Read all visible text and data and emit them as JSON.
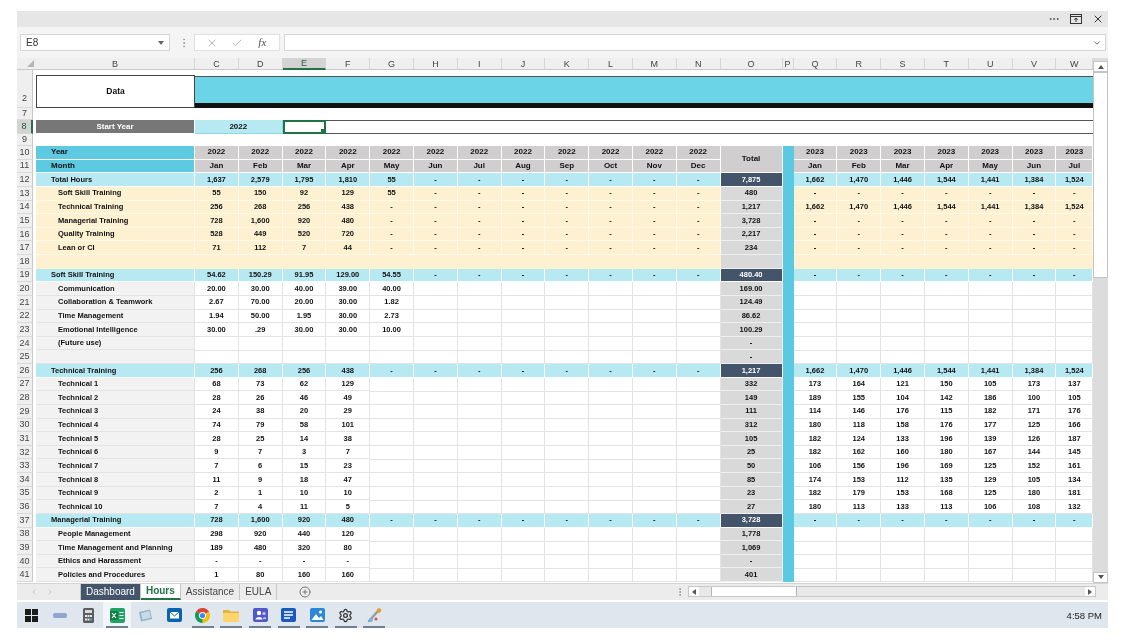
{
  "formula_bar": {
    "name_box": "E8",
    "function_label": "fx"
  },
  "columns": [
    {
      "label": "B",
      "selected": false
    },
    {
      "label": "C",
      "selected": false
    },
    {
      "label": "D",
      "selected": false
    },
    {
      "label": "E",
      "selected": true
    },
    {
      "label": "F",
      "selected": false
    },
    {
      "label": "G",
      "selected": false
    },
    {
      "label": "H",
      "selected": false
    },
    {
      "label": "I",
      "selected": false
    },
    {
      "label": "J",
      "selected": false
    },
    {
      "label": "K",
      "selected": false
    },
    {
      "label": "L",
      "selected": false
    },
    {
      "label": "M",
      "selected": false
    },
    {
      "label": "N",
      "selected": false
    },
    {
      "label": "O",
      "selected": false
    },
    {
      "label": "P",
      "selected": false
    },
    {
      "label": "Q",
      "selected": false
    },
    {
      "label": "R",
      "selected": false
    },
    {
      "label": "S",
      "selected": false
    },
    {
      "label": "T",
      "selected": false
    },
    {
      "label": "U",
      "selected": false
    },
    {
      "label": "V",
      "selected": false
    },
    {
      "label": "W",
      "selected": false
    }
  ],
  "rows": [
    {
      "kind": "banner",
      "number": "2",
      "selected": false,
      "label": "Data"
    },
    {
      "kind": "blank",
      "number": "7",
      "selected": false
    },
    {
      "kind": "start_year",
      "number": "8",
      "selected": true,
      "label": "Start Year",
      "value": "2022"
    },
    {
      "kind": "blank",
      "number": "9",
      "selected": false
    },
    {
      "kind": "header",
      "number": "10",
      "selected": false,
      "label": "Year",
      "values_2022": [
        "2022",
        "2022",
        "2022",
        "2022",
        "2022",
        "2022",
        "2022",
        "2022",
        "2022",
        "2022",
        "2022",
        "2022"
      ],
      "total": "Total",
      "values_2023": [
        "2023",
        "2023",
        "2023",
        "2023",
        "2023",
        "2023",
        "2023"
      ]
    },
    {
      "kind": "header",
      "number": "11",
      "selected": false,
      "label": "Month",
      "values_2022": [
        "Jan",
        "Feb",
        "Mar",
        "Apr",
        "May",
        "Jun",
        "Jul",
        "Aug",
        "Sep",
        "Oct",
        "Nov",
        "Dec"
      ],
      "values_2023": [
        "Jan",
        "Feb",
        "Mar",
        "Apr",
        "May",
        "Jun",
        "Jul"
      ]
    },
    {
      "kind": "section",
      "number": "12",
      "selected": false,
      "label": "Total Hours",
      "values_2022": [
        "1,637",
        "2,579",
        "1,795",
        "1,810",
        "55",
        "-",
        "-",
        "-",
        "-",
        "-",
        "-",
        "-"
      ],
      "total": "7,875",
      "values_2023": [
        "1,662",
        "1,470",
        "1,446",
        "1,544",
        "1,441",
        "1,384",
        "1,524"
      ]
    },
    {
      "kind": "breakdown",
      "number": "13",
      "selected": false,
      "label": "Soft Skill Training",
      "values_2022": [
        "55",
        "150",
        "92",
        "129",
        "55",
        "-",
        "-",
        "-",
        "-",
        "-",
        "-",
        "-"
      ],
      "total": "480",
      "values_2023": [
        "-",
        "-",
        "-",
        "-",
        "-",
        "-",
        "-"
      ]
    },
    {
      "kind": "breakdown",
      "number": "14",
      "selected": false,
      "label": "Technical Training",
      "values_2022": [
        "256",
        "268",
        "256",
        "438",
        "-",
        "-",
        "-",
        "-",
        "-",
        "-",
        "-",
        "-"
      ],
      "total": "1,217",
      "values_2023": [
        "1,662",
        "1,470",
        "1,446",
        "1,544",
        "1,441",
        "1,384",
        "1,524"
      ]
    },
    {
      "kind": "breakdown",
      "number": "15",
      "selected": false,
      "label": "Managerial Training",
      "values_2022": [
        "728",
        "1,600",
        "920",
        "480",
        "-",
        "-",
        "-",
        "-",
        "-",
        "-",
        "-",
        "-"
      ],
      "total": "3,728",
      "values_2023": [
        "-",
        "-",
        "-",
        "-",
        "-",
        "-",
        "-"
      ]
    },
    {
      "kind": "breakdown",
      "number": "16",
      "selected": false,
      "label": "Quality Training",
      "values_2022": [
        "528",
        "449",
        "520",
        "720",
        "-",
        "-",
        "-",
        "-",
        "-",
        "-",
        "-",
        "-"
      ],
      "total": "2,217",
      "values_2023": [
        "-",
        "-",
        "-",
        "-",
        "-",
        "-",
        "-"
      ]
    },
    {
      "kind": "breakdown",
      "number": "17",
      "selected": false,
      "label": "Lean or CI",
      "values_2022": [
        "71",
        "112",
        "7",
        "44",
        "-",
        "-",
        "-",
        "-",
        "-",
        "-",
        "-",
        "-"
      ],
      "total": "234",
      "values_2023": [
        "-",
        "-",
        "-",
        "-",
        "-",
        "-",
        "-"
      ]
    },
    {
      "kind": "spacer",
      "number": "18",
      "selected": false
    },
    {
      "kind": "section",
      "number": "19",
      "selected": false,
      "label": "Soft Skill Training",
      "values_2022": [
        "54.62",
        "150.29",
        "91.95",
        "129.00",
        "54.55",
        "-",
        "-",
        "-",
        "-",
        "-",
        "-",
        "-"
      ],
      "total": "480.40",
      "values_2023": [
        "-",
        "-",
        "-",
        "-",
        "-",
        "-",
        "-"
      ]
    },
    {
      "kind": "item",
      "number": "20",
      "selected": false,
      "label": "Communication",
      "values_2022": [
        "20.00",
        "30.00",
        "40.00",
        "39.00",
        "40.00"
      ],
      "total": "169.00"
    },
    {
      "kind": "item",
      "number": "21",
      "selected": false,
      "label": "Collaboration & Teamwork",
      "values_2022": [
        "2.67",
        "70.00",
        "20.00",
        "30.00",
        "1.82"
      ],
      "total": "124.49"
    },
    {
      "kind": "item",
      "number": "22",
      "selected": false,
      "label": "Time Management",
      "values_2022": [
        "1.94",
        "50.00",
        "1.95",
        "30.00",
        "2.73"
      ],
      "total": "86.62"
    },
    {
      "kind": "item",
      "number": "23",
      "selected": false,
      "label": "Emotional Intelligence",
      "values_2022": [
        "30.00",
        ".29",
        "30.00",
        "30.00",
        "10.00"
      ],
      "total": "100.29"
    },
    {
      "kind": "item",
      "number": "24",
      "selected": false,
      "label": "(Future use)",
      "total": "-"
    },
    {
      "kind": "item",
      "number": "25",
      "selected": false,
      "total": "-"
    },
    {
      "kind": "section",
      "number": "26",
      "selected": false,
      "label": "Technical Training",
      "values_2022": [
        "256",
        "268",
        "256",
        "438",
        "-",
        "-",
        "-",
        "-",
        "-",
        "-",
        "-",
        "-"
      ],
      "total": "1,217",
      "values_2023": [
        "1,662",
        "1,470",
        "1,446",
        "1,544",
        "1,441",
        "1,384",
        "1,524"
      ]
    },
    {
      "kind": "item",
      "number": "27",
      "selected": false,
      "label": "Technical 1",
      "values_2022": [
        "68",
        "73",
        "62",
        "129"
      ],
      "total": "332",
      "values_2023": [
        "173",
        "164",
        "121",
        "150",
        "105",
        "173",
        "137"
      ]
    },
    {
      "kind": "item",
      "number": "28",
      "selected": false,
      "label": "Technical 2",
      "values_2022": [
        "28",
        "26",
        "46",
        "49"
      ],
      "total": "149",
      "values_2023": [
        "189",
        "155",
        "104",
        "142",
        "186",
        "100",
        "105"
      ]
    },
    {
      "kind": "item",
      "number": "29",
      "selected": false,
      "label": "Technical 3",
      "values_2022": [
        "24",
        "38",
        "20",
        "29"
      ],
      "total": "111",
      "values_2023": [
        "114",
        "146",
        "176",
        "115",
        "182",
        "171",
        "176"
      ]
    },
    {
      "kind": "item",
      "number": "30",
      "selected": false,
      "label": "Technical 4",
      "values_2022": [
        "74",
        "79",
        "58",
        "101"
      ],
      "total": "312",
      "values_2023": [
        "180",
        "118",
        "158",
        "176",
        "177",
        "125",
        "166"
      ]
    },
    {
      "kind": "item",
      "number": "31",
      "selected": false,
      "label": "Technical 5",
      "values_2022": [
        "28",
        "25",
        "14",
        "38"
      ],
      "total": "105",
      "values_2023": [
        "182",
        "124",
        "133",
        "196",
        "139",
        "126",
        "187"
      ]
    },
    {
      "kind": "item",
      "number": "32",
      "selected": false,
      "label": "Technical 6",
      "values_2022": [
        "9",
        "7",
        "3",
        "7"
      ],
      "total": "25",
      "values_2023": [
        "182",
        "162",
        "160",
        "180",
        "167",
        "144",
        "145"
      ]
    },
    {
      "kind": "item",
      "number": "33",
      "selected": false,
      "label": "Technical 7",
      "values_2022": [
        "7",
        "6",
        "15",
        "23"
      ],
      "total": "50",
      "values_2023": [
        "106",
        "156",
        "196",
        "169",
        "125",
        "152",
        "161"
      ]
    },
    {
      "kind": "item",
      "number": "34",
      "selected": false,
      "label": "Technical 8",
      "values_2022": [
        "11",
        "9",
        "18",
        "47"
      ],
      "total": "85",
      "values_2023": [
        "174",
        "153",
        "112",
        "135",
        "129",
        "105",
        "134"
      ]
    },
    {
      "kind": "item",
      "number": "35",
      "selected": false,
      "label": "Technical 9",
      "values_2022": [
        "2",
        "1",
        "10",
        "10"
      ],
      "total": "23",
      "values_2023": [
        "182",
        "179",
        "153",
        "168",
        "125",
        "180",
        "181"
      ]
    },
    {
      "kind": "item",
      "number": "36",
      "selected": false,
      "label": "Technical 10",
      "values_2022": [
        "7",
        "4",
        "11",
        "5"
      ],
      "total": "27",
      "values_2023": [
        "180",
        "113",
        "133",
        "113",
        "106",
        "108",
        "132"
      ]
    },
    {
      "kind": "section",
      "number": "37",
      "selected": false,
      "label": "Managerial Training",
      "values_2022": [
        "728",
        "1,600",
        "920",
        "480",
        "-",
        "-",
        "-",
        "-",
        "-",
        "-",
        "-",
        "-"
      ],
      "total": "3,728",
      "values_2023": [
        "-",
        "-",
        "-",
        "-",
        "-",
        "-",
        "-"
      ]
    },
    {
      "kind": "item",
      "number": "38",
      "selected": false,
      "label": "People Management",
      "values_2022": [
        "298",
        "920",
        "440",
        "120"
      ],
      "total": "1,778"
    },
    {
      "kind": "item",
      "number": "39",
      "selected": false,
      "label": "Time Management and Planning",
      "values_2022": [
        "189",
        "480",
        "320",
        "80"
      ],
      "total": "1,069"
    },
    {
      "kind": "item",
      "number": "40",
      "selected": false,
      "label": "Ethics and Harassment",
      "values_2022": [
        "-",
        "-",
        "-",
        "-"
      ],
      "total": "-"
    },
    {
      "kind": "item",
      "number": "41",
      "selected": false,
      "label": "Policies and Procedures",
      "values_2022": [
        "1",
        "80",
        "160",
        "160"
      ],
      "total": "401"
    }
  ],
  "sheet_tabs": [
    {
      "label": "Dashboard",
      "selected": false,
      "color": "#44546a"
    },
    {
      "label": "Hours",
      "selected": true
    },
    {
      "label": "Assistance",
      "selected": false
    },
    {
      "label": "EULA",
      "selected": false
    }
  ],
  "taskbar": {
    "apps": [
      {
        "kind": "dash",
        "running": false,
        "selected": false
      },
      {
        "kind": "calculator",
        "running": false,
        "selected": false
      },
      {
        "kind": "spreadsheet",
        "running": true,
        "selected": true
      },
      {
        "kind": "tablet",
        "running": false,
        "selected": false
      },
      {
        "kind": "mail",
        "running": false,
        "selected": false
      },
      {
        "kind": "browser",
        "running": true,
        "selected": false
      },
      {
        "kind": "folder",
        "running": true,
        "selected": false
      },
      {
        "kind": "people",
        "running": true,
        "selected": false
      },
      {
        "kind": "document",
        "running": true,
        "selected": false
      },
      {
        "kind": "image",
        "running": true,
        "selected": false
      },
      {
        "kind": "settings",
        "running": true,
        "selected": false
      },
      {
        "kind": "paint",
        "running": true,
        "selected": false
      }
    ],
    "clock": "4:58 PM"
  }
}
